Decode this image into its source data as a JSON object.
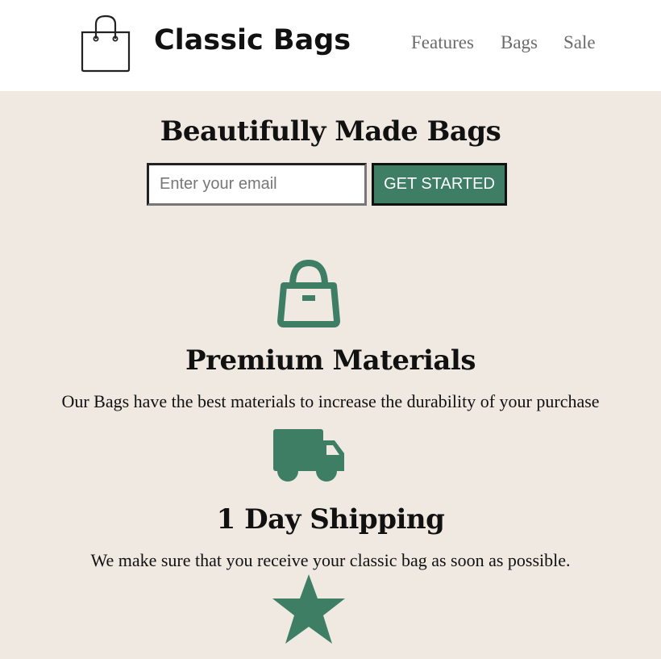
{
  "header": {
    "brand_name": "Classic Bags",
    "logo_icon": "shopping-bag-outline-icon",
    "nav": [
      {
        "label": "Features"
      },
      {
        "label": "Bags"
      },
      {
        "label": "Sale"
      }
    ]
  },
  "hero": {
    "title": "Beautifully Made Bags",
    "email_placeholder": "Enter your email",
    "email_value": "",
    "cta_label": "GET STARTED"
  },
  "features": [
    {
      "icon": "handbag-icon",
      "title": "Premium Materials",
      "description": "Our Bags have the best materials to increase the durability of your purchase"
    },
    {
      "icon": "truck-icon",
      "title": "1 Day Shipping",
      "description": "We make sure that you receive your classic bag as soon as possible."
    },
    {
      "icon": "star-icon",
      "title": "",
      "description": ""
    }
  ],
  "colors": {
    "accent": "#3d7e65",
    "page_background": "#f0e9e2",
    "header_background": "#ffffff",
    "nav_text": "#6b6b6b"
  }
}
